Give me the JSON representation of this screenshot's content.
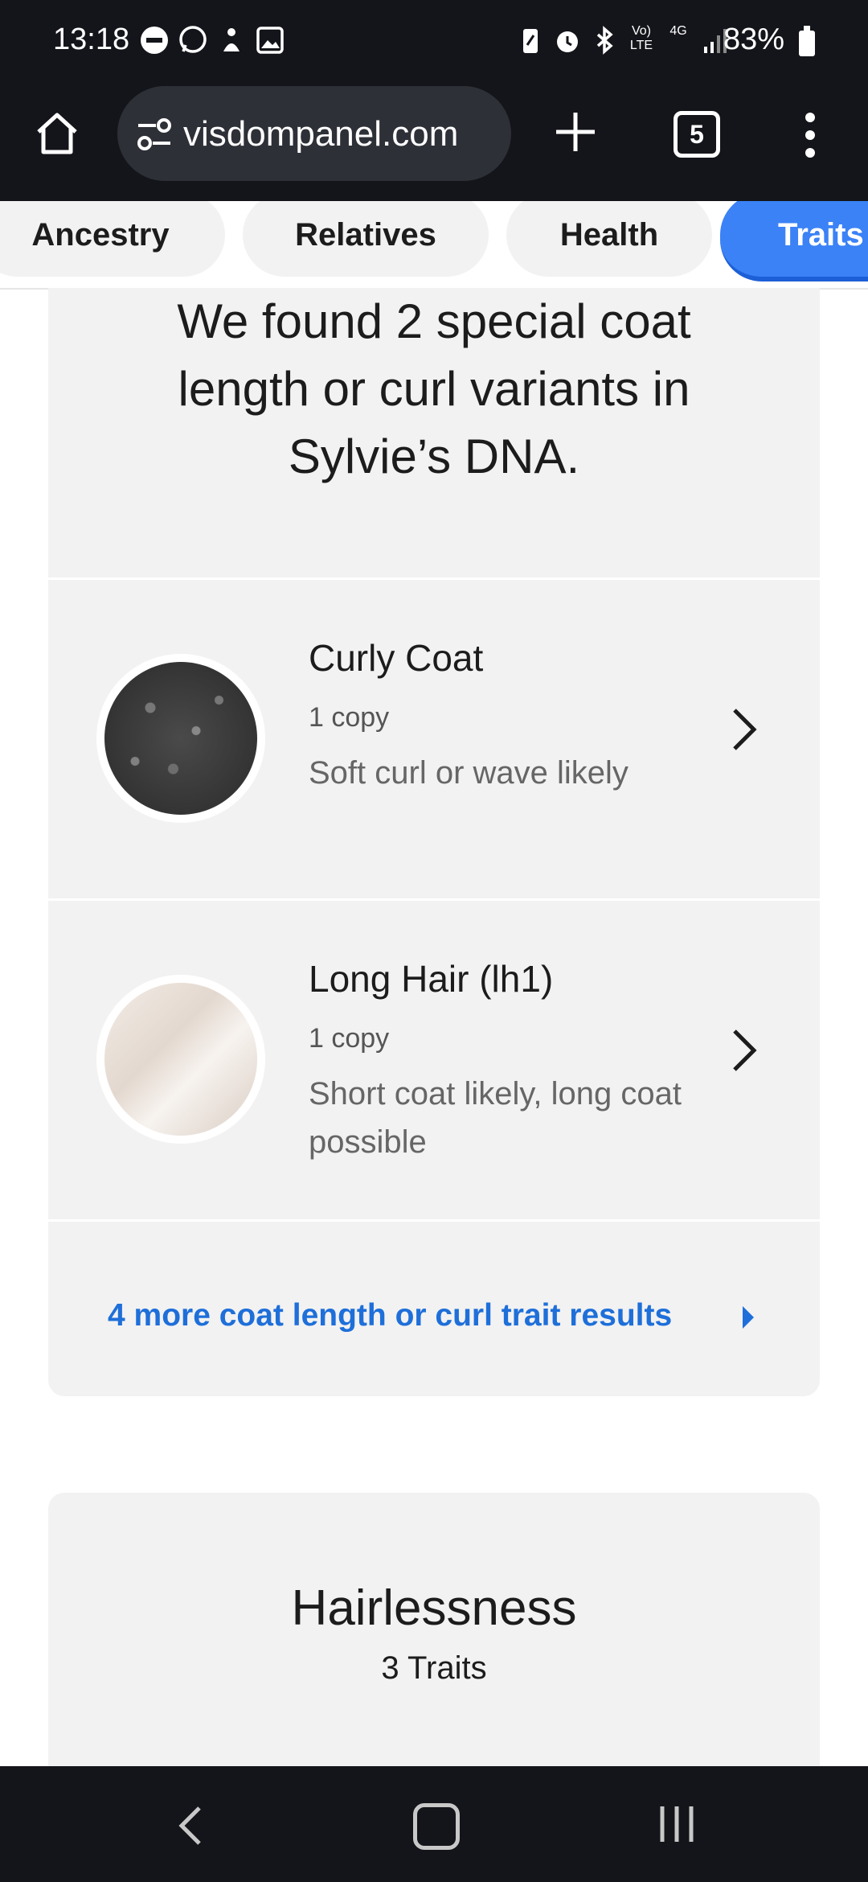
{
  "status_bar": {
    "time": "13:18",
    "signal_label_top": "Vo) LTE",
    "network_label": "4G",
    "battery_percent": "83%",
    "left_icons": [
      "do-not-disturb-icon",
      "whatsapp-icon",
      "notification-icon",
      "gallery-icon"
    ],
    "right_icons": [
      "battery-saver-icon",
      "alarm-icon",
      "bluetooth-icon",
      "volte-icon",
      "4g-icon",
      "signal-icon"
    ]
  },
  "browser": {
    "url": "visdompanel.com",
    "tab_count": "5"
  },
  "nav_tabs": [
    {
      "label": "Ancestry",
      "active": false
    },
    {
      "label": "Relatives",
      "active": false
    },
    {
      "label": "Health",
      "active": false
    },
    {
      "label": "Traits",
      "active": true
    }
  ],
  "card": {
    "heading_lines": [
      "We found 2 special coat",
      "length or curl variants in",
      "Sylvie’s DNA."
    ],
    "traits": [
      {
        "name": "Curly Coat",
        "copies": "1 copy",
        "description": "Soft curl or wave likely"
      },
      {
        "name": "Long Hair (lh1)",
        "copies": "1 copy",
        "description": "Short coat likely, long coat possible"
      }
    ],
    "more_link": "4 more coat length or curl trait results"
  },
  "card2": {
    "title": "Hairlessness",
    "subtitle": "3 Traits"
  },
  "colors": {
    "accent": "#3b82f6",
    "link": "#1e6fd9",
    "card_bg": "#f2f2f2",
    "dark_bar": "#14151a"
  }
}
